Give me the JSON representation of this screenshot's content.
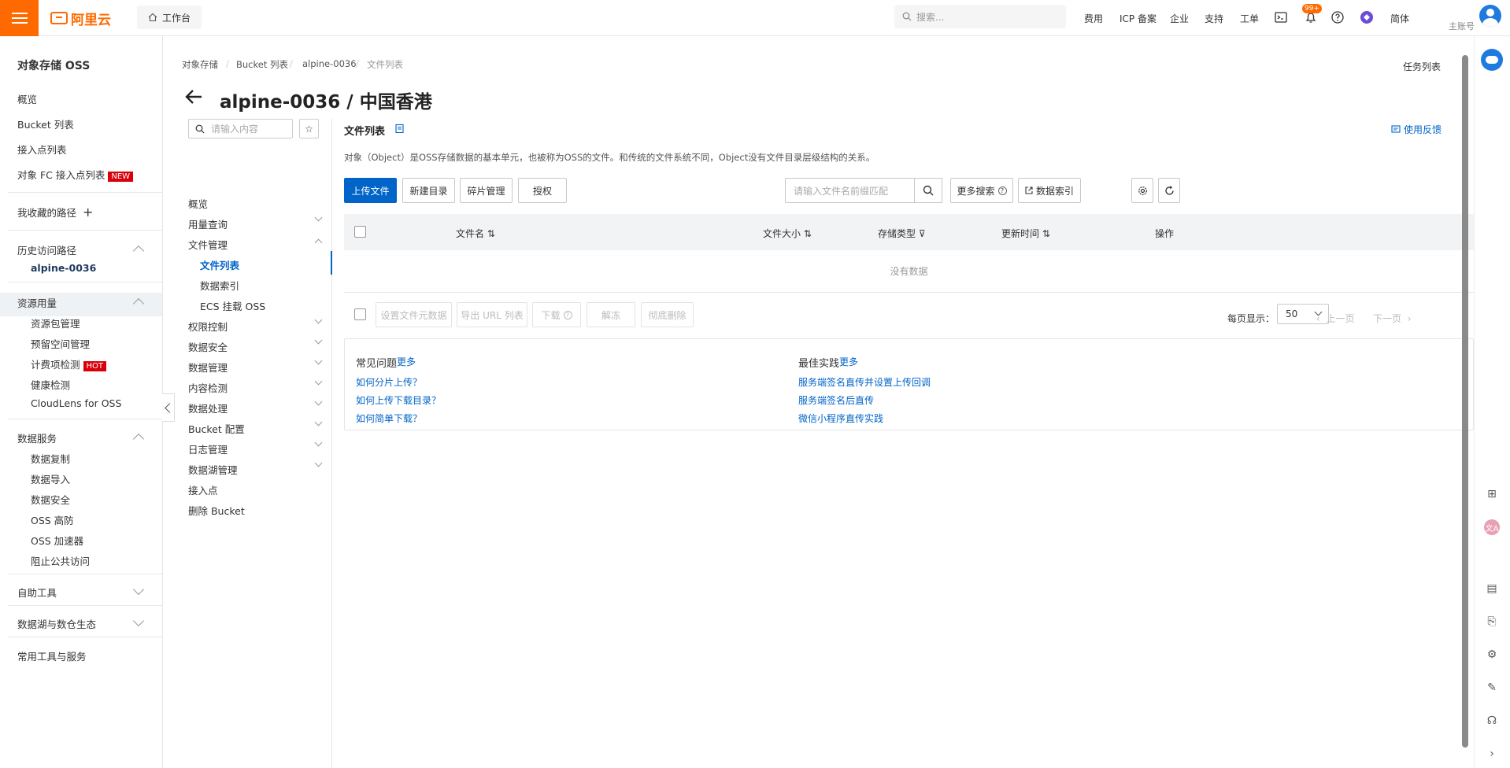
{
  "topbar": {
    "logo_text": "阿里云",
    "workbench": "工作台",
    "search_placeholder": "搜索...",
    "links": [
      "费用",
      "ICP 备案",
      "企业",
      "支持",
      "工单"
    ],
    "badge": "99+",
    "language": "简体",
    "account": "主账号",
    "brand_color": "#ff6a00"
  },
  "leftnav": {
    "title": "对象存储 OSS",
    "items": [
      "概览",
      "Bucket 列表",
      "接入点列表",
      "对象 FC 接入点列表"
    ],
    "new_tag": "NEW",
    "favorites": "我收藏的路径",
    "history": "历史访问路径",
    "history_item": "alpine-0036",
    "resource_group": "资源用量",
    "resource_items": [
      "资源包管理",
      "预留空间管理",
      "计费项检测",
      "健康检测",
      "CloudLens for OSS"
    ],
    "hot_tag": "HOT",
    "data_service": "数据服务",
    "data_service_items": [
      "数据复制",
      "数据导入",
      "数据安全",
      "OSS 高防",
      "OSS 加速器",
      "阻止公共访问"
    ],
    "self_tools": "自助工具",
    "data_lake": "数据湖与数仓生态",
    "partial": "常用工具与服务"
  },
  "main": {
    "breadcrumb": [
      "对象存储",
      "Bucket 列表",
      "alpine-0036",
      "文件列表"
    ],
    "title": "alpine-0036 / 中国香港",
    "task_list": "任务列表"
  },
  "subnav": {
    "search_placeholder": "请输入内容",
    "items": [
      {
        "label": "概览",
        "chevron": ""
      },
      {
        "label": "用量查询",
        "chevron": "down"
      },
      {
        "label": "文件管理",
        "chevron": "up"
      },
      {
        "label": "文件列表",
        "sub": true,
        "active": true
      },
      {
        "label": "数据索引",
        "sub": true
      },
      {
        "label": "ECS 挂载 OSS",
        "sub": true
      },
      {
        "label": "权限控制",
        "chevron": "down"
      },
      {
        "label": "数据安全",
        "chevron": "down"
      },
      {
        "label": "数据管理",
        "chevron": "down"
      },
      {
        "label": "内容检测",
        "chevron": "down"
      },
      {
        "label": "数据处理",
        "chevron": "down"
      },
      {
        "label": "Bucket 配置",
        "chevron": "down"
      },
      {
        "label": "日志管理",
        "chevron": "down"
      },
      {
        "label": "数据湖管理",
        "chevron": "down"
      },
      {
        "label": "接入点",
        "chevron": ""
      },
      {
        "label": "删除 Bucket",
        "chevron": ""
      }
    ]
  },
  "filelist": {
    "title": "文件列表",
    "description": "对象（Object）是OSS存储数据的基本单元，也被称为OSS的文件。和传统的文件系统不同，Object没有文件目录层级结构的关系。",
    "feedback": "使用反馈",
    "buttons": {
      "upload": "上传文件",
      "new_dir": "新建目录",
      "fragments": "碎片管理",
      "auth": "授权",
      "more_search": "更多搜索",
      "data_index": "数据索引"
    },
    "search_placeholder": "请输入文件名前缀匹配",
    "columns": [
      "文件名",
      "文件大小",
      "存储类型",
      "更新时间",
      "操作"
    ],
    "no_data": "没有数据",
    "bulk": {
      "set_meta": "设置文件元数据",
      "export_url": "导出 URL 列表",
      "download": "下载",
      "unfreeze": "解冻",
      "delete": "彻底删除"
    },
    "per_page_label": "每页显示：",
    "per_page": "50",
    "prev": "上一页",
    "next": "下一页",
    "accent": "#0064c8"
  },
  "faq": {
    "title": "常见问题",
    "more": "更多",
    "links": [
      "如何分片上传？",
      "如何上传下载目录？",
      "如何简单下载？"
    ],
    "best_title": "最佳实践",
    "best_more": "更多",
    "best_links": [
      "服务端签名直传并设置上传回调",
      "服务端签名后直传",
      "微信小程序直传实践"
    ]
  }
}
